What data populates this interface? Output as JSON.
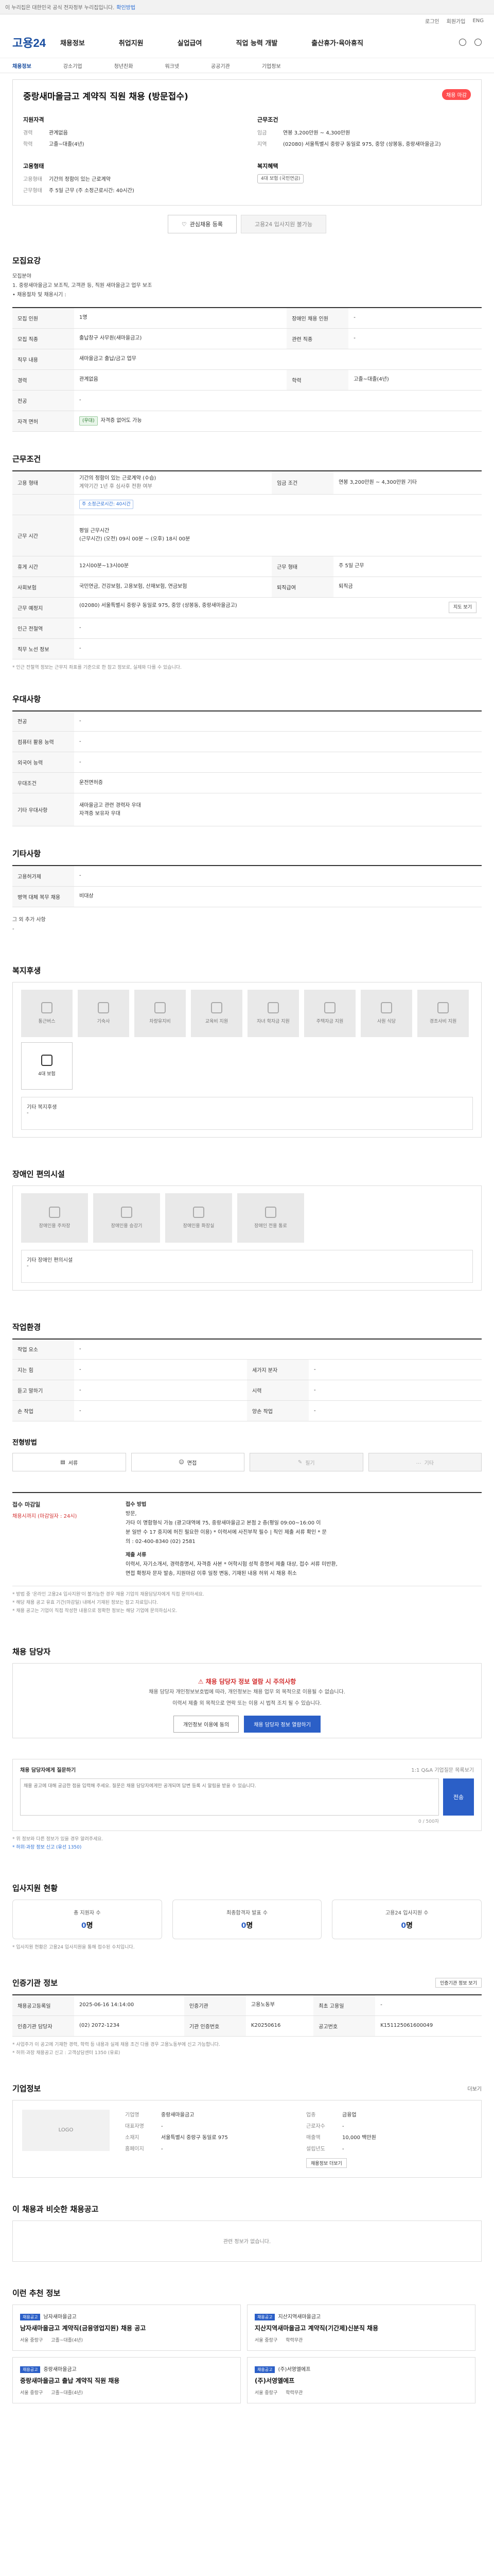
{
  "topbar": {
    "text": "이 누리집은 대한민국 공식 전자정부 누리집입니다.",
    "link": "확인방법"
  },
  "util": [
    "로그인",
    "회원가입",
    "ENG"
  ],
  "header": {
    "logo": "고용24",
    "nav": [
      "채용정보",
      "취업지원",
      "실업급여",
      "직업 능력 개발",
      "출산휴가·육아휴직"
    ]
  },
  "crumbs": [
    "채용정보",
    "강소기업",
    "청년친화",
    "워크넷",
    "공공기관",
    "기업정보"
  ],
  "job": {
    "title": "중랑새마을금고 계약직 직원 채용 (방문접수)",
    "badge": "채용 마감",
    "left_heading": "지원자격",
    "left": [
      {
        "k": "경력",
        "v": "관계없음"
      },
      {
        "k": "학력",
        "v": "고졸~대졸(4년)"
      }
    ],
    "left2_heading": "고용형태",
    "left2": [
      {
        "k": "고용형태",
        "v": "기간의 정함이 있는 근로계약"
      },
      {
        "k": "근무형태",
        "v": "주 5일 근무 (주 소정근로시간: 40시간)"
      }
    ],
    "right_heading": "근무조건",
    "right": [
      {
        "k": "임금",
        "v": "연봉 3,200만원 ~ 4,300만원"
      },
      {
        "k": "지역",
        "v": "(02080) 서울특별시 중랑구 동일로 975, 중앙 (상봉동, 중랑새마을금고)"
      }
    ],
    "right2_heading": "복지혜택",
    "right2_tag": "4대 보험 (국민연금)",
    "btn_save": "관심채용 등록",
    "btn_apply": "고용24 입사지원 불가능"
  },
  "recruit": {
    "title": "모집요강",
    "lines": [
      "모집분야",
      "1. 중랑새마을금고 보조직, 고객관 등, 직원 새마을금고 업무 보조",
      "• 채용절차 및 채용시기 :"
    ],
    "rows": [
      {
        "k": "모집 인원",
        "v": "1명",
        "k2": "장애인 채용 인원",
        "v2": "-"
      },
      {
        "k": "모집 직종",
        "v": "출납창구 사무원(새마을금고)",
        "k2": "관련 직종",
        "v2": "-"
      },
      {
        "k": "직무 내용",
        "v": "새마을금고 출납/금고 업무",
        "k2": "",
        "v2": ""
      },
      {
        "k": "경력",
        "v": "관계없음",
        "k2": "학력",
        "v2": "고졸~대졸(4년)"
      },
      {
        "k": "전공",
        "v": "-",
        "k2": "",
        "v2": ""
      },
      {
        "k": "자격 면허",
        "v": "자격증 없어도 가능",
        "tag": "(우대)",
        "k2": "",
        "v2": ""
      }
    ]
  },
  "work": {
    "title": "근무조건",
    "rows": [
      {
        "k": "고용 형태",
        "v": "기간의 정함이 있는 근로계약 (수습)",
        "v_sub": "계약기간 1년 후 심사후 전환 여부",
        "k2": "임금 조건",
        "v2": "연봉 3,200만원 ~ 4,300만원 기타"
      },
      {
        "k": "",
        "v": "주 소정근로시간: 40시간",
        "k2": "",
        "v2": ""
      },
      {
        "k": "근무 시간",
        "v": "평일 근무시간",
        "v_sub": "(근무시간) (오전) 09시 00분 ~ (오후) 18시 00분",
        "k2": "",
        "v2": ""
      },
      {
        "k": "휴게 시간",
        "v": "12시00분~13시00분",
        "k2": "근무 형태",
        "v2": "주 5일 근무"
      },
      {
        "k": "사회보험",
        "v": "국민연금, 건강보험, 고용보험, 산재보험, 연금보험",
        "k2": "퇴직급여",
        "v2": "퇴직금"
      },
      {
        "k": "근무 예정지",
        "v": "(02080) 서울특별시 중랑구 동일로 975, 중앙 (상봉동, 중랑새마을금고)",
        "btn": "지도 보기",
        "k2": "",
        "v2": ""
      },
      {
        "k": "인근 전철역",
        "v": "-",
        "k2": "",
        "v2": ""
      },
      {
        "k": "직무 노선 정보",
        "v": "-",
        "k2": "",
        "v2": ""
      }
    ],
    "note": "* 인근 전철역 정보는 근무지 좌표를 기준으로 한 참고 정보로, 실제와 다를 수 있습니다."
  },
  "pref": {
    "title": "우대사항",
    "rows": [
      {
        "k": "전공",
        "v": "-"
      },
      {
        "k": "컴퓨터 활용 능력",
        "v": "-"
      },
      {
        "k": "외국어 능력",
        "v": "-"
      },
      {
        "k": "우대조건",
        "v": "운전면허증"
      },
      {
        "k": "기타 우대사항",
        "v": "새마을금고 관련 경력자 우대",
        "v_sub": "자격증 보유자 우대"
      }
    ]
  },
  "other": {
    "title": "기타사항",
    "rows": [
      {
        "k": "고용허가제",
        "v": "-"
      },
      {
        "k": "병역 대체 복무 채용",
        "v": "비대상"
      }
    ],
    "extra_label": "그 외 추가 사항",
    "extra_value": "-"
  },
  "welfare": {
    "title": "복지후생",
    "items": [
      "통근버스",
      "기숙사",
      "차량유지비",
      "교육비 지원",
      "자녀 학자금 지원",
      "주택자금 지원",
      "사원 식당",
      "경조사비 지원",
      "4대 보험"
    ],
    "extra_label": "기타 복지후생",
    "extra_value": "-"
  },
  "disability": {
    "title": "장애인 편의시설",
    "items": [
      "장애인용 주차장",
      "장애인용 승강기",
      "장애인용 화장실",
      "장애인 전용 통로"
    ],
    "extra_label": "기타 장애인 편의시설",
    "extra_value": "-"
  },
  "envir": {
    "title": "작업환경",
    "rows": [
      {
        "k": "작업 요소",
        "v": "-",
        "k2": "",
        "v2": ""
      },
      {
        "k": "지는 힘",
        "v": "-",
        "k2": "세가지 분자",
        "v2": "-"
      },
      {
        "k": "듣고 말하기",
        "v": "-",
        "k2": "시력",
        "v2": "-"
      },
      {
        "k": "손 작업",
        "v": "-",
        "k2": "양손 작업",
        "v2": "-"
      }
    ],
    "method_title": "전형방법",
    "method": [
      "서류",
      "면접",
      "필기",
      "기타"
    ]
  },
  "apply": {
    "title": "접수 마감일",
    "deadline": "채용시까지 (마감일자 : 24시)",
    "method_label": "접수 방법",
    "method_lines": [
      "방문,",
      "가타 이 명함형식 가능 (광고대역에 75, 중랑새마을금고 본점 2 층(평일 09:00~16:00 이",
      "분 일반 수 17 중지에 허진 필요한 이용) * 이력서에 사진부착 필수 | 직인 제출 서류 확인 * 문",
      "의 : 02-400-8340 (02) 2581",
      "제출 서류",
      "이력서, 자기소개서, 경력증명서, 자격증 사본 * 어학시험 성적 증명서 제출 대상, 접수 서류 미반환,",
      "면접 확정자 문자 발송, 지원마감 이후 일정 변동, 기재된 내용 허위 시 채용 취소"
    ],
    "notes": [
      "* 방법 중 '온라인 고용24 입사지원'이 불가능한 경우 채용 기업의 채용담당자에게 직접 문의하세요.",
      "* 해당 채용 공고 유효 기간(마감일) 내에서 기재된 정보는 참고 자료입니다.",
      "* 채용 공고는 기업이 직접 작성한 내용으로 정확한 정보는 해당 기업에 문의하십시오."
    ]
  },
  "contact": {
    "title": "채용 담당자",
    "warn_title": "채용 담당자 정보 열람 시 주의사항",
    "warn_lines": [
      "채용 담당자 개인정보보호법에 따라, 개인정보는 채용 업무 외 목적으로 이용될 수 없습니다.",
      "이력서 제출 외 목적으로 연락 또는 이용 시 법적 조치 될 수 있습니다."
    ],
    "btn_agree": "개인정보 이용에 동의",
    "btn_view": "채용 담당자 정보 열람하기"
  },
  "inquiry": {
    "title": "채용 담당자에게 질문하기",
    "link": "1:1 Q&A 기업질문 목록보기",
    "placeholder": "채용 공고에 대해 궁금한 점을 입력해 주세요. 질문은 채용 담당자에게만 공개되며 답변 등록 시 알림을 받을 수 있습니다.",
    "count": "0 / 500자",
    "btn": "전송",
    "notes": [
      "* 위 정보와 다른 정보가 있을 경우 알려주세요.",
      "* 허위·과장 정보 신고 (유선 1350)"
    ]
  },
  "stats": {
    "title": "입사지원 현황",
    "items": [
      {
        "label": "총 지원자 수",
        "value": "0",
        "unit": "명"
      },
      {
        "label": "최종합격자 발표 수",
        "value": "0",
        "unit": "명"
      },
      {
        "label": "고용24 입사지원 수",
        "value": "0",
        "unit": "명"
      }
    ],
    "note": "* 입사지원 현황은 고용24 입사지원을 통해 접수된 수치입니다."
  },
  "info": {
    "title": "인증기관 정보",
    "btn": "인증기관 정보 보기",
    "rows": [
      {
        "k": "채용공고등록일",
        "v": "2025-06-16 14:14:00",
        "k2": "인증기관",
        "v2": "고용노동부",
        "k3": "최초 고용일",
        "v3": "-"
      },
      {
        "k": "인증기관 담당자",
        "v": "(02) 2072-1234",
        "k2": "기관 인증번호",
        "v2": "K20250616",
        "k3": "공고번호",
        "v3": "K151125061600049"
      }
    ],
    "notes": [
      "* 사업주가 이 공고에 기재한 경력, 학력 등 내용과 실제 채용 조건 다를 경우 고용노동부에 신고 가능합니다.",
      "* 허위·과장 채용공고 신고 : 고객상담센터 1350 (유료)"
    ]
  },
  "company": {
    "title": "기업정보",
    "more": "더보기",
    "logo_text": "LOGO",
    "rows": [
      {
        "k": "기업명",
        "v": "중랑새마을금고",
        "k2": "업종",
        "v2": "금융업"
      },
      {
        "k": "대표자명",
        "v": "-",
        "k2": "근로자수",
        "v2": "-"
      },
      {
        "k": "소재지",
        "v": "서울특별시 중랑구 동일로 975",
        "k2": "매출액",
        "v2": "10,000 백만원"
      },
      {
        "k": "홈페이지",
        "v": "-",
        "k2": "설립년도",
        "v2": "-"
      }
    ],
    "btn": "채용정보 더보기"
  },
  "similar": {
    "title": "이 채용과 비슷한 채용공고",
    "empty": "관련 정보가 없습니다."
  },
  "recommend": {
    "title": "이런 추천 정보",
    "cards": [
      {
        "tag": "채용공고",
        "company": "남자새마을금고",
        "title": "남자새마을금고 계약직(금융영업지원) 채용 공고",
        "loc": "서울 중랑구",
        "edu": "고졸~대졸(4년)"
      },
      {
        "tag": "채용공고",
        "company": "지산지역새마을금고",
        "title": "지산지역새마을금고 계약직(기간제)신분직 채용",
        "loc": "서울 중랑구",
        "edu": "학력무관"
      },
      {
        "tag": "채용공고",
        "company": "중랑새마을금고",
        "title": "중랑새마을금고 출납 계약직 직원 채용",
        "loc": "서울 중랑구",
        "edu": "고졸~대졸(4년)"
      },
      {
        "tag": "채용공고",
        "company": "(주)서영엘에프",
        "title": "(주)서영엘에프",
        "loc": "서울 중랑구",
        "edu": "학력무관"
      }
    ]
  }
}
